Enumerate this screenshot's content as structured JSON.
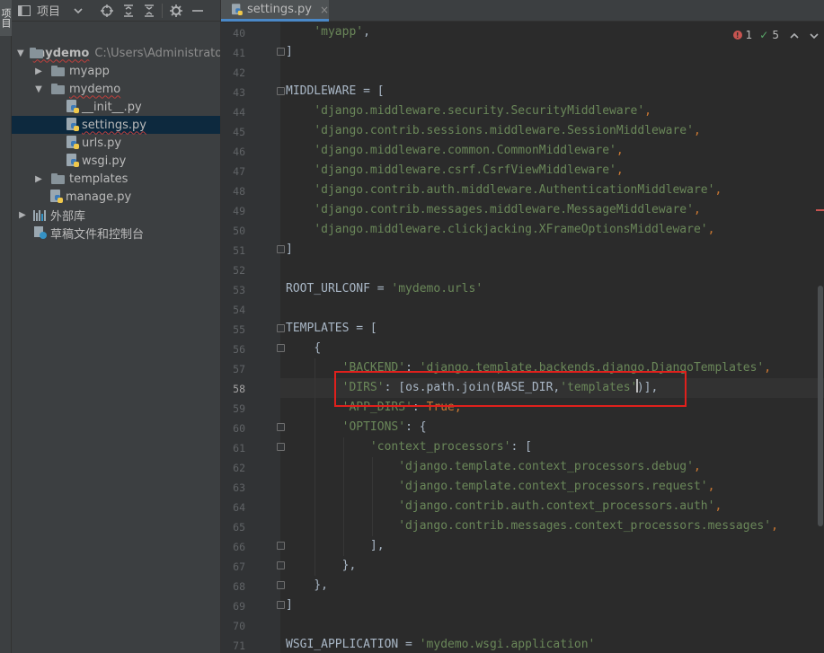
{
  "left_strip": {
    "tab_label": "项目"
  },
  "project_toolbar": {
    "title": "项目",
    "icons": [
      "project-icon",
      "chevron-down-icon",
      "target-icon",
      "expand-all-icon",
      "collapse-all-icon",
      "gear-icon",
      "minimize-icon"
    ]
  },
  "tree": {
    "root_name": "mydemo",
    "root_path": "C:\\Users\\Administrator",
    "items": [
      {
        "label": "myapp"
      },
      {
        "label": "mydemo"
      },
      {
        "label": "__init__.py"
      },
      {
        "label": "settings.py"
      },
      {
        "label": "urls.py"
      },
      {
        "label": "wsgi.py"
      },
      {
        "label": "templates"
      },
      {
        "label": "manage.py"
      },
      {
        "label": "外部库"
      },
      {
        "label": "草稿文件和控制台"
      }
    ]
  },
  "editor": {
    "tab_label": "settings.py",
    "tab_close": "×",
    "inspection": {
      "errors": "1",
      "checks": "5"
    },
    "current_line": "58",
    "line_numbers": [
      "40",
      "41",
      "42",
      "43",
      "44",
      "45",
      "46",
      "47",
      "48",
      "49",
      "50",
      "51",
      "52",
      "53",
      "54",
      "55",
      "56",
      "57",
      "58",
      "59",
      "60",
      "61",
      "62",
      "63",
      "64",
      "65",
      "66",
      "67",
      "68",
      "69",
      "70",
      "71"
    ],
    "lines": {
      "l40": {
        "s": "'myapp'",
        "p": ","
      },
      "l41": {
        "t": "]"
      },
      "l43": {
        "t": "MIDDLEWARE = ["
      },
      "l44": {
        "s": "'django.middleware.security.SecurityMiddleware'",
        "p": ","
      },
      "l45": {
        "s": "'django.contrib.sessions.middleware.SessionMiddleware'",
        "p": ","
      },
      "l46": {
        "s": "'django.middleware.common.CommonMiddleware'",
        "p": ","
      },
      "l47": {
        "s": "'django.middleware.csrf.CsrfViewMiddleware'",
        "p": ","
      },
      "l48": {
        "s": "'django.contrib.auth.middleware.AuthenticationMiddleware'",
        "p": ","
      },
      "l49": {
        "s": "'django.contrib.messages.middleware.MessageMiddleware'",
        "p": ","
      },
      "l50": {
        "s": "'django.middleware.clickjacking.XFrameOptionsMiddleware'",
        "p": ","
      },
      "l51": {
        "t": "]"
      },
      "l53": {
        "a": "ROOT_URLCONF = ",
        "s": "'mydemo.urls'"
      },
      "l55": {
        "t": "TEMPLATES = ["
      },
      "l56": {
        "t": "{"
      },
      "l57": {
        "s1": "'BACKEND'",
        "p1": ": ",
        "s2": "'django.template.backends.django.DjangoTemplates'",
        "p2": ","
      },
      "l58": {
        "s1": "'DIRS'",
        "p1": ": [os.path.join(BASE_DIR,",
        "s2": "'templates'",
        "s3": "",
        "p2": ")],"
      },
      "l59": {
        "s1": "'APP_DIRS'",
        "p1": ": ",
        "k": "True",
        "p2": ","
      },
      "l60": {
        "s1": "'OPTIONS'",
        "p1": ": {"
      },
      "l61": {
        "s1": "'context_processors'",
        "p1": ": ["
      },
      "l62": {
        "s": "'django.template.context_processors.debug'",
        "p": ","
      },
      "l63": {
        "s": "'django.template.context_processors.request'",
        "p": ","
      },
      "l64": {
        "s": "'django.contrib.auth.context_processors.auth'",
        "p": ","
      },
      "l65": {
        "s": "'django.contrib.messages.context_processors.messages'",
        "p": ","
      },
      "l66": {
        "t": "],"
      },
      "l67": {
        "t": "},"
      },
      "l68": {
        "t": "},"
      },
      "l69": {
        "t": "]"
      },
      "l71": {
        "a": "WSGI_APPLICATION = ",
        "s": "'mydemo.wsgi.application'"
      }
    }
  }
}
